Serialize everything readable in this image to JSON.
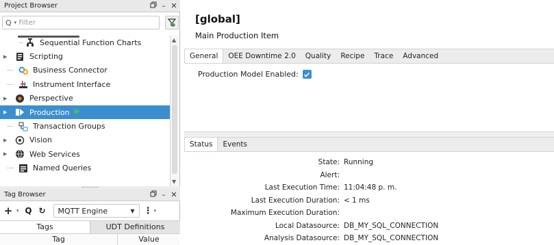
{
  "project_browser": {
    "title": "Project Browser",
    "filter_placeholder": "Filter",
    "tree_items": [
      {
        "label": "Sequential Function Charts",
        "icon": "sfc-icon"
      },
      {
        "label": "Scripting",
        "icon": "scripting-icon"
      },
      {
        "label": "Business Connector",
        "icon": "business-connector-icon"
      },
      {
        "label": "Instrument Interface",
        "icon": "instrument-interface-icon"
      },
      {
        "label": "Perspective",
        "icon": "perspective-icon"
      },
      {
        "label": "Production",
        "icon": "production-icon",
        "selected": true
      },
      {
        "label": "Transaction Groups",
        "icon": "transaction-groups-icon"
      },
      {
        "label": "Vision",
        "icon": "vision-icon"
      },
      {
        "label": "Web Services",
        "icon": "web-services-icon"
      },
      {
        "label": "Named Queries",
        "icon": "named-queries-icon"
      }
    ]
  },
  "tag_browser": {
    "title": "Tag Browser",
    "provider": "MQTT Engine",
    "tabs": [
      "Tags",
      "UDT Definitions"
    ],
    "columns": [
      "Tag",
      "Value"
    ]
  },
  "editor": {
    "title": "[global]",
    "subtitle": "Main Production Item",
    "tabs": [
      "General",
      "OEE Downtime 2.0",
      "Quality",
      "Recipe",
      "Trace",
      "Advanced"
    ],
    "production_model_label": "Production Model Enabled:",
    "production_model_enabled": true,
    "status_tabs": [
      "Status",
      "Events"
    ],
    "status_rows": [
      {
        "label": "State:",
        "value": "Running"
      },
      {
        "label": "Alert:",
        "value": ""
      },
      {
        "label": "Last Execution Time:",
        "value": "11:04:48 p. m."
      },
      {
        "label": "Last Execution Duration:",
        "value": "< 1 ms"
      },
      {
        "label": "Maximum Execution Duration:",
        "value": ""
      },
      {
        "label": "Local Datasource:",
        "value": "DB_MY_SQL_CONNECTION"
      },
      {
        "label": "Analysis Datasource:",
        "value": "DB_MY_SQL_CONNECTION"
      }
    ]
  },
  "colors": {
    "selection": "#3b8fd0",
    "checkbox": "#3b8fd0"
  }
}
